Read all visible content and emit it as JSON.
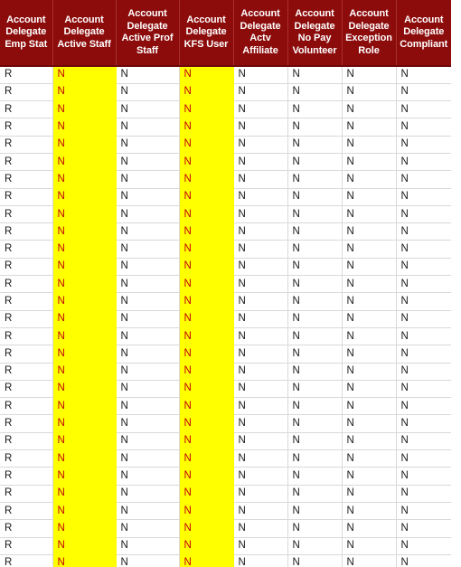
{
  "table": {
    "columns": [
      {
        "id": "account-delegate-emp-stat",
        "label": "Account Delegate Emp Stat",
        "highlighted": false
      },
      {
        "id": "account-delegate-active-staff",
        "label": "Account Delegate Active Staff",
        "highlighted": true
      },
      {
        "id": "account-delegate-active-prof-staff",
        "label": "Account Delegate Active Prof Staff",
        "highlighted": false
      },
      {
        "id": "account-delegate-kfs-user",
        "label": "Account Delegate KFS User",
        "highlighted": true
      },
      {
        "id": "account-delegate-actv-affiliate",
        "label": "Account Delegate Actv Affiliate",
        "highlighted": false
      },
      {
        "id": "account-delegate-no-pay-volunteer",
        "label": "Account Delegate No Pay Volunteer",
        "highlighted": false
      },
      {
        "id": "account-delegate-exception-role",
        "label": "Account Delegate Exception Role",
        "highlighted": false
      },
      {
        "id": "account-delegate-compliant",
        "label": "Account Delegate Compliant",
        "highlighted": false
      }
    ],
    "rows": [
      [
        "R",
        "N",
        "N",
        "N",
        "N",
        "N",
        "N",
        "N"
      ],
      [
        "R",
        "N",
        "N",
        "N",
        "N",
        "N",
        "N",
        "N"
      ],
      [
        "R",
        "N",
        "N",
        "N",
        "N",
        "N",
        "N",
        "N"
      ],
      [
        "R",
        "N",
        "N",
        "N",
        "N",
        "N",
        "N",
        "N"
      ],
      [
        "R",
        "N",
        "N",
        "N",
        "N",
        "N",
        "N",
        "N"
      ],
      [
        "R",
        "N",
        "N",
        "N",
        "N",
        "N",
        "N",
        "N"
      ],
      [
        "R",
        "N",
        "N",
        "N",
        "N",
        "N",
        "N",
        "N"
      ],
      [
        "R",
        "N",
        "N",
        "N",
        "N",
        "N",
        "N",
        "N"
      ],
      [
        "R",
        "N",
        "N",
        "N",
        "N",
        "N",
        "N",
        "N"
      ],
      [
        "R",
        "N",
        "N",
        "N",
        "N",
        "N",
        "N",
        "N"
      ],
      [
        "R",
        "N",
        "N",
        "N",
        "N",
        "N",
        "N",
        "N"
      ],
      [
        "R",
        "N",
        "N",
        "N",
        "N",
        "N",
        "N",
        "N"
      ],
      [
        "R",
        "N",
        "N",
        "N",
        "N",
        "N",
        "N",
        "N"
      ],
      [
        "R",
        "N",
        "N",
        "N",
        "N",
        "N",
        "N",
        "N"
      ],
      [
        "R",
        "N",
        "N",
        "N",
        "N",
        "N",
        "N",
        "N"
      ],
      [
        "R",
        "N",
        "N",
        "N",
        "N",
        "N",
        "N",
        "N"
      ],
      [
        "R",
        "N",
        "N",
        "N",
        "N",
        "N",
        "N",
        "N"
      ],
      [
        "R",
        "N",
        "N",
        "N",
        "N",
        "N",
        "N",
        "N"
      ],
      [
        "R",
        "N",
        "N",
        "N",
        "N",
        "N",
        "N",
        "N"
      ],
      [
        "R",
        "N",
        "N",
        "N",
        "N",
        "N",
        "N",
        "N"
      ],
      [
        "R",
        "N",
        "N",
        "N",
        "N",
        "N",
        "N",
        "N"
      ],
      [
        "R",
        "N",
        "N",
        "N",
        "N",
        "N",
        "N",
        "N"
      ],
      [
        "R",
        "N",
        "N",
        "N",
        "N",
        "N",
        "N",
        "N"
      ],
      [
        "R",
        "N",
        "N",
        "N",
        "N",
        "N",
        "N",
        "N"
      ],
      [
        "R",
        "N",
        "N",
        "N",
        "N",
        "N",
        "N",
        "N"
      ],
      [
        "R",
        "N",
        "N",
        "N",
        "N",
        "N",
        "N",
        "N"
      ],
      [
        "R",
        "N",
        "N",
        "N",
        "N",
        "N",
        "N",
        "N"
      ],
      [
        "R",
        "N",
        "N",
        "N",
        "N",
        "N",
        "N",
        "N"
      ],
      [
        "R",
        "N",
        "N",
        "N",
        "N",
        "N",
        "N",
        "N"
      ]
    ]
  },
  "colors": {
    "header_background": "#8C0B0B",
    "header_text": "#FFFFFF",
    "highlight_background": "#FFFF00",
    "highlight_text": "#C00000",
    "cell_text": "#1A1A1A",
    "gridline": "#D9D9D9"
  }
}
